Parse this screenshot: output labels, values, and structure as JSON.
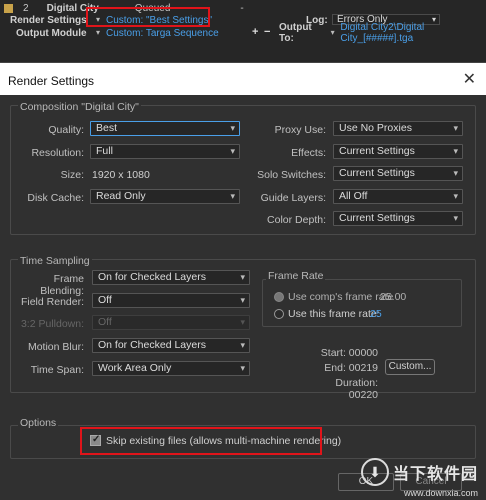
{
  "queue": {
    "row1": {
      "number": "2",
      "comp_name": "Digital City",
      "status": "Queued",
      "dash": "-"
    },
    "row2": {
      "label": "Render Settings",
      "value": "Custom: \"Best Settings\"",
      "log_label": "Log:",
      "log_value": "Errors Only"
    },
    "row3": {
      "label": "Output Module",
      "value": "Custom: Targa Sequence",
      "plus": "+",
      "minus": "−",
      "output_to_label": "Output To:",
      "output_to_value": "Digital City2\\Digital City_[#####].tga"
    }
  },
  "dialog": {
    "title": "Render Settings",
    "close": "✕",
    "composition": {
      "group_title": "Composition \"Digital City\"",
      "quality_label": "Quality:",
      "quality_value": "Best",
      "resolution_label": "Resolution:",
      "resolution_value": "Full",
      "size_label": "Size:",
      "size_value": "1920 x 1080",
      "disk_cache_label": "Disk Cache:",
      "disk_cache_value": "Read Only",
      "proxy_label": "Proxy Use:",
      "proxy_value": "Use No Proxies",
      "effects_label": "Effects:",
      "effects_value": "Current Settings",
      "solo_label": "Solo Switches:",
      "solo_value": "Current Settings",
      "guide_label": "Guide Layers:",
      "guide_value": "All Off",
      "color_depth_label": "Color Depth:",
      "color_depth_value": "Current Settings"
    },
    "time_sampling": {
      "group_title": "Time Sampling",
      "frame_blending_label": "Frame Blending:",
      "frame_blending_value": "On for Checked Layers",
      "field_render_label": "Field Render:",
      "field_render_value": "Off",
      "pulldown_label": "3:2 Pulldown:",
      "pulldown_value": "Off",
      "motion_blur_label": "Motion Blur:",
      "motion_blur_value": "On for Checked Layers",
      "time_span_label": "Time Span:",
      "time_span_value": "Work Area Only",
      "frame_rate_title": "Frame Rate",
      "use_comp_rate_label": "Use comp's frame rate",
      "use_comp_rate_value": "25.00",
      "use_this_rate_label": "Use this frame rate:",
      "use_this_rate_value": "25",
      "start_label": "Start:",
      "start_value": "00000",
      "end_label": "End:",
      "end_value": "00219",
      "custom_button": "Custom...",
      "duration_label": "Duration:",
      "duration_value": "00220"
    },
    "options": {
      "group_title": "Options",
      "skip_existing_label": "Skip existing files (allows multi-machine rendering)",
      "skip_existing_checked": true
    },
    "footer": {
      "ok_label": "OK",
      "cancel_label": "Cancel"
    }
  },
  "watermark": {
    "text": "当下软件园",
    "url": "www.downxia.com",
    "icon": "down-arrow-icon"
  },
  "colors": {
    "highlight": "#e0141a",
    "accent": "#4a9fe8"
  }
}
